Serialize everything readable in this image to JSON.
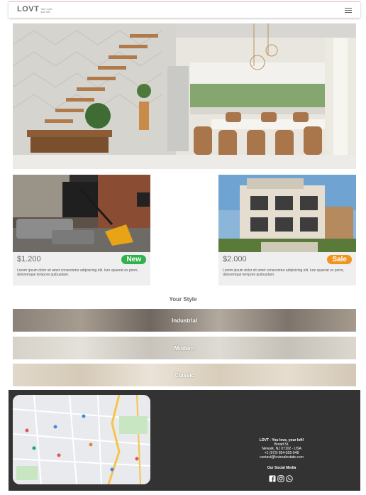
{
  "header": {
    "logo_text": "LOVT",
    "logo_tagline": "Your Love, your loft.",
    "menu_icon": "hamburger-icon"
  },
  "hero": {
    "image": "modern-loft-interior-photo"
  },
  "cards": [
    {
      "image": "loft-living-room-photo",
      "price": "$1.200",
      "badge": "New",
      "badge_color": "#2fb24c",
      "description": "Lorem ipsum dolor sit amet consectetur adipisicing elit. Iure quaerat ex porro, doloremque tempore quibusdam."
    },
    {
      "image": "modern-house-exterior-photo",
      "price": "$2.000",
      "badge": "Sale",
      "badge_color": "#f0941f",
      "description": "Lorem ipsum dolor sit amet consectetur adipisicing elit. Iure quaerat ex porro, doloremque tempore quibusdam."
    }
  ],
  "styles": {
    "title": "Your Style",
    "items": [
      {
        "label": "Industrial",
        "tint": "#7a7066"
      },
      {
        "label": "Modern",
        "tint": "#c9c4b9"
      },
      {
        "label": "Classic",
        "tint": "#d9cfbf"
      }
    ]
  },
  "footer": {
    "map_image": "street-map",
    "contact_lines": [
      "LOVT - You love, your loft!",
      "Broad St.",
      "Newark, NJ 07102 - USA",
      "+1 (973) 854-555-548",
      "contact@lovtrealestate.com"
    ],
    "social_title": "Our Social Media",
    "social_icons": [
      "facebook-icon",
      "instagram-icon",
      "whatsapp-icon"
    ]
  }
}
